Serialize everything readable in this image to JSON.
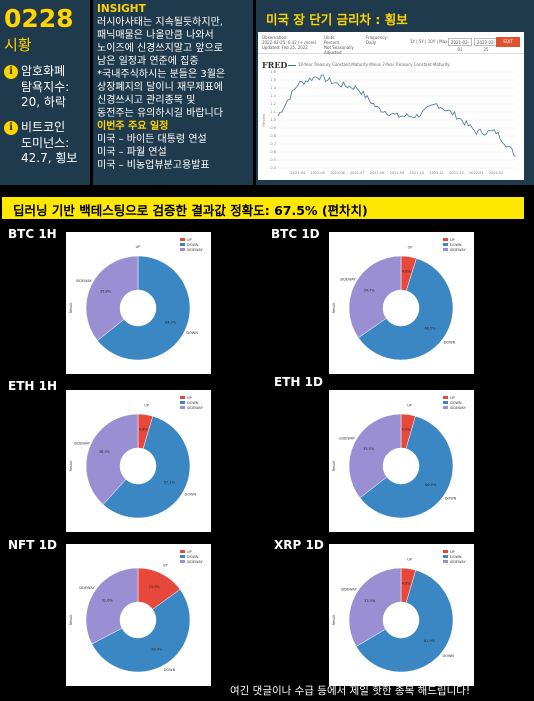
{
  "left_panel": {
    "date": "0228",
    "market": "시황",
    "stats": [
      {
        "icon": "info-icon",
        "text": "암호화폐\n탐욕지수:\n20, 하락"
      },
      {
        "icon": "info-icon",
        "text": "비트코인\n도미넌스:\n42.7, 횡보"
      }
    ]
  },
  "insight": {
    "title": "INSIGHT",
    "body": "러시아사태는 지속될듯하지만,\n패닉매물은 나올만큼 나와서\n노이즈에 신경쓰지말고 앞으로\n남은 일정과 연준에 집중\n*국내주식하시는 분들은 3월은\n상장폐지의 달이니 재무제표에\n신경쓰시고 관리종목 및\n동전주는 유의하시길 바랍니다",
    "schedule_title": "이번주 주요 일정",
    "schedule": [
      "미국 – 바이든 대통령 연설",
      "미국 – 파월 연설",
      "미국 – 비농업뷰분고용발표"
    ]
  },
  "rate_panel": {
    "title": "미국 장 단기 금리차 : 횡보",
    "fred": {
      "logo": "FRED",
      "legend": "10-Year Treasury Constant Maturity Minus 2-Year Treasury Constant Maturity",
      "observation_label": "Observation:",
      "observation_value": "2022-02-25: 0.42 (+ more)",
      "updated": "Updated: Feb 25, 2022",
      "units_label": "Units:",
      "units_value": "Percent,\nNot Seasonally Adjusted",
      "frequency_label": "Frequency:",
      "frequency_value": "Daily",
      "range_presets": "1Y | 5Y | 10Y | Max",
      "date_from": "2021-02-01",
      "date_to": "2022-02-25",
      "edit_button": "EDIT GRAPH",
      "y_axis_label": "Percent",
      "y_ticks": [
        "1.6",
        "1.5",
        "1.4",
        "1.3",
        "1.2",
        "1.1",
        "1.0",
        "0.9",
        "0.8",
        "0.7",
        "0.6",
        "0.5",
        "0.4"
      ],
      "x_ticks": [
        "2021-04",
        "2021-05",
        "2021-06",
        "2021-07",
        "2021-08",
        "2021-09",
        "2021-10",
        "2021-11",
        "2021-12",
        "2022-01",
        "2022-02"
      ]
    }
  },
  "banner": "딥러닝 기반 백테스팅으로 검증한 결과값 정확도: 67.5% (편차치)",
  "charts": [
    {
      "label": "BTC 1H"
    },
    {
      "label": "BTC 1D"
    },
    {
      "label": "ETH 1H"
    },
    {
      "label": "ETH 1D"
    },
    {
      "label": "NFT 1D"
    },
    {
      "label": "XRP 1D"
    }
  ],
  "chart_data": [
    {
      "type": "pie",
      "name": "BTC 1H",
      "legend": [
        "UP",
        "DOWN",
        "SIDEWAY"
      ],
      "slice_labels": [
        "UP",
        "DOWN",
        "SIDEWAY"
      ],
      "values": [
        0,
        64.2,
        35.8
      ],
      "value_labels": [
        "0.0%",
        "64.2%",
        "35.8%"
      ],
      "y_label": "Result",
      "colors": [
        "#e8483b",
        "#3a87c4",
        "#9b8fd4"
      ]
    },
    {
      "type": "pie",
      "name": "BTC 1D",
      "legend": [
        "UP",
        "DOWN",
        "SIDEWAY"
      ],
      "slice_labels": [
        "UP",
        "DOWN",
        "SIDEWAY"
      ],
      "values": [
        4.8,
        60.5,
        34.7
      ],
      "value_labels": [
        "4.8%",
        "60.5%",
        "34.7%"
      ],
      "y_label": "Result",
      "colors": [
        "#e8483b",
        "#3a87c4",
        "#9b8fd4"
      ]
    },
    {
      "type": "pie",
      "name": "ETH 1H",
      "legend": [
        "UP",
        "DOWN",
        "SIDEWAY"
      ],
      "slice_labels": [
        "UP",
        "DOWN",
        "SIDEWAY"
      ],
      "values": [
        4.6,
        57.1,
        38.3
      ],
      "value_labels": [
        "4.6%",
        "57.1%",
        "38.3%"
      ],
      "y_label": "Result",
      "colors": [
        "#e8483b",
        "#3a87c4",
        "#9b8fd4"
      ]
    },
    {
      "type": "pie",
      "name": "ETH 1D",
      "legend": [
        "UP",
        "DOWN",
        "SIDEWAY"
      ],
      "slice_labels": [
        "UP",
        "DOWN",
        "SIDEWAY"
      ],
      "values": [
        4.5,
        60.0,
        35.5
      ],
      "value_labels": [
        "4.5%",
        "60.0%",
        "35.5%"
      ],
      "y_label": "Result",
      "colors": [
        "#e8483b",
        "#3a87c4",
        "#9b8fd4"
      ]
    },
    {
      "type": "pie",
      "name": "NFT 1D",
      "legend": [
        "UP",
        "DOWN",
        "SIDEWAY"
      ],
      "slice_labels": [
        "UP",
        "DOWN",
        "SIDEWAY"
      ],
      "values": [
        15.0,
        52.4,
        32.6
      ],
      "value_labels": [
        "15.0%",
        "52.4%",
        "32.6%"
      ],
      "y_label": "Result",
      "colors": [
        "#e8483b",
        "#3a87c4",
        "#9b8fd4"
      ]
    },
    {
      "type": "pie",
      "name": "XRP 1D",
      "legend": [
        "UP",
        "DOWN",
        "SIDEWAY"
      ],
      "slice_labels": [
        "UP",
        "DOWN",
        "SIDEWAY"
      ],
      "values": [
        4.6,
        61.9,
        33.5
      ],
      "value_labels": [
        "4.6%",
        "61.9%",
        "33.5%"
      ],
      "y_label": "Result",
      "colors": [
        "#e8483b",
        "#3a87c4",
        "#9b8fd4"
      ]
    }
  ],
  "fred_series": {
    "type": "line",
    "x": [
      "2021-02",
      "2021-03",
      "2021-04",
      "2021-05",
      "2021-06",
      "2021-07",
      "2021-08",
      "2021-09",
      "2021-10",
      "2021-11",
      "2021-12",
      "2022-01",
      "2022-02"
    ],
    "y": [
      1.05,
      1.45,
      1.55,
      1.45,
      1.4,
      1.15,
      1.05,
      1.05,
      1.2,
      1.05,
      0.85,
      0.85,
      0.55
    ],
    "ylim": [
      0.4,
      1.6
    ],
    "color": "#4572a7"
  },
  "footer": "여긴 댓글이나 수급 등에서 제일 핫한 종목 해드립니다!"
}
